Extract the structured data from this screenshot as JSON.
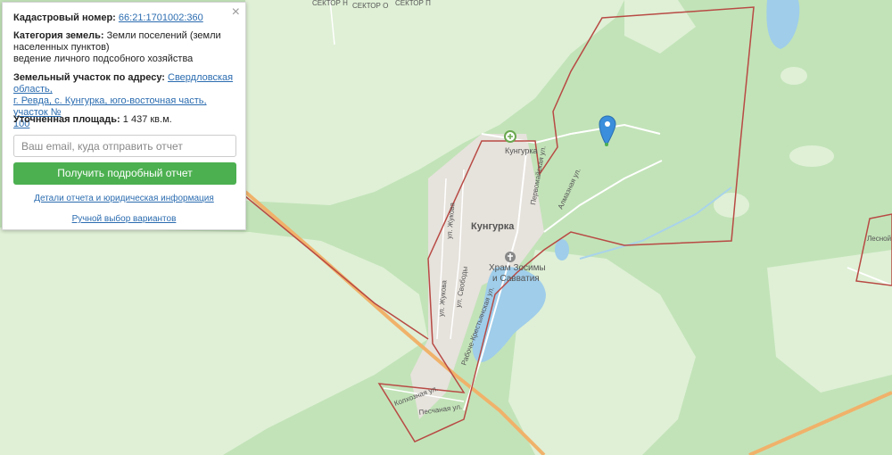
{
  "info_panel": {
    "cadastral_label": "Кадастровый номер:",
    "cadastral_number": "66:21:1701002:360",
    "category_label": "Категория земель:",
    "category_value_1": "Земли поселений (земли",
    "category_value_2": "населенных пунктов)",
    "category_value_3": "ведение личного подсобного хозяйства",
    "address_label": "Земельный участок по адресу:",
    "address_line_1": "Свердловская область,",
    "address_line_2": "г. Ревда, с. Кунгурка, юго-восточная часть, участок №",
    "address_line_3": "100",
    "area_label": "Уточненная площадь:",
    "area_value": "1 437 кв.м.",
    "email_placeholder": "Ваш email, куда отправить отчет",
    "report_button": "Получить подробный отчет",
    "details_link": "Детали отчета и юридическая информация",
    "manual_link": "Ручной выбор вариантов",
    "close_symbol": "×"
  },
  "map": {
    "village_name": "Кунгурка",
    "village_poi": "Кунгурка",
    "church_line_1": "Храм Зосимы",
    "church_line_2": "и Савватия",
    "sector_1": "СЕКТОР Н",
    "sector_2": "СЕКТОР О",
    "sector_3": "СЕКТОР П",
    "street_zhukova": "ул. Жукова",
    "street_zhukova_2": "ул. Жукова",
    "street_svobody": "ул. Свободы",
    "street_krestyanskaya": "Рабоче-Крестьянская ул.",
    "street_pervomayskaya": "Первомайская ул.",
    "street_almaznaya": "Алмазная ул.",
    "street_kolkhoznaya": "Колхозная ул.",
    "street_peschanaya": "Песчаная ул.",
    "edge_label": "Лесной"
  },
  "colors": {
    "forest": "#c2e3b8",
    "field": "#dff0d6",
    "water": "#9fcdea",
    "boundary": "#b84a44",
    "road": "#f0b26a",
    "button": "#4cb050",
    "link": "#2b6cb0",
    "marker": "#3a8edb"
  },
  "icons": {
    "marker": "map-pin-icon",
    "poi": "village-poi-icon",
    "church": "church-icon",
    "close": "close-icon"
  }
}
